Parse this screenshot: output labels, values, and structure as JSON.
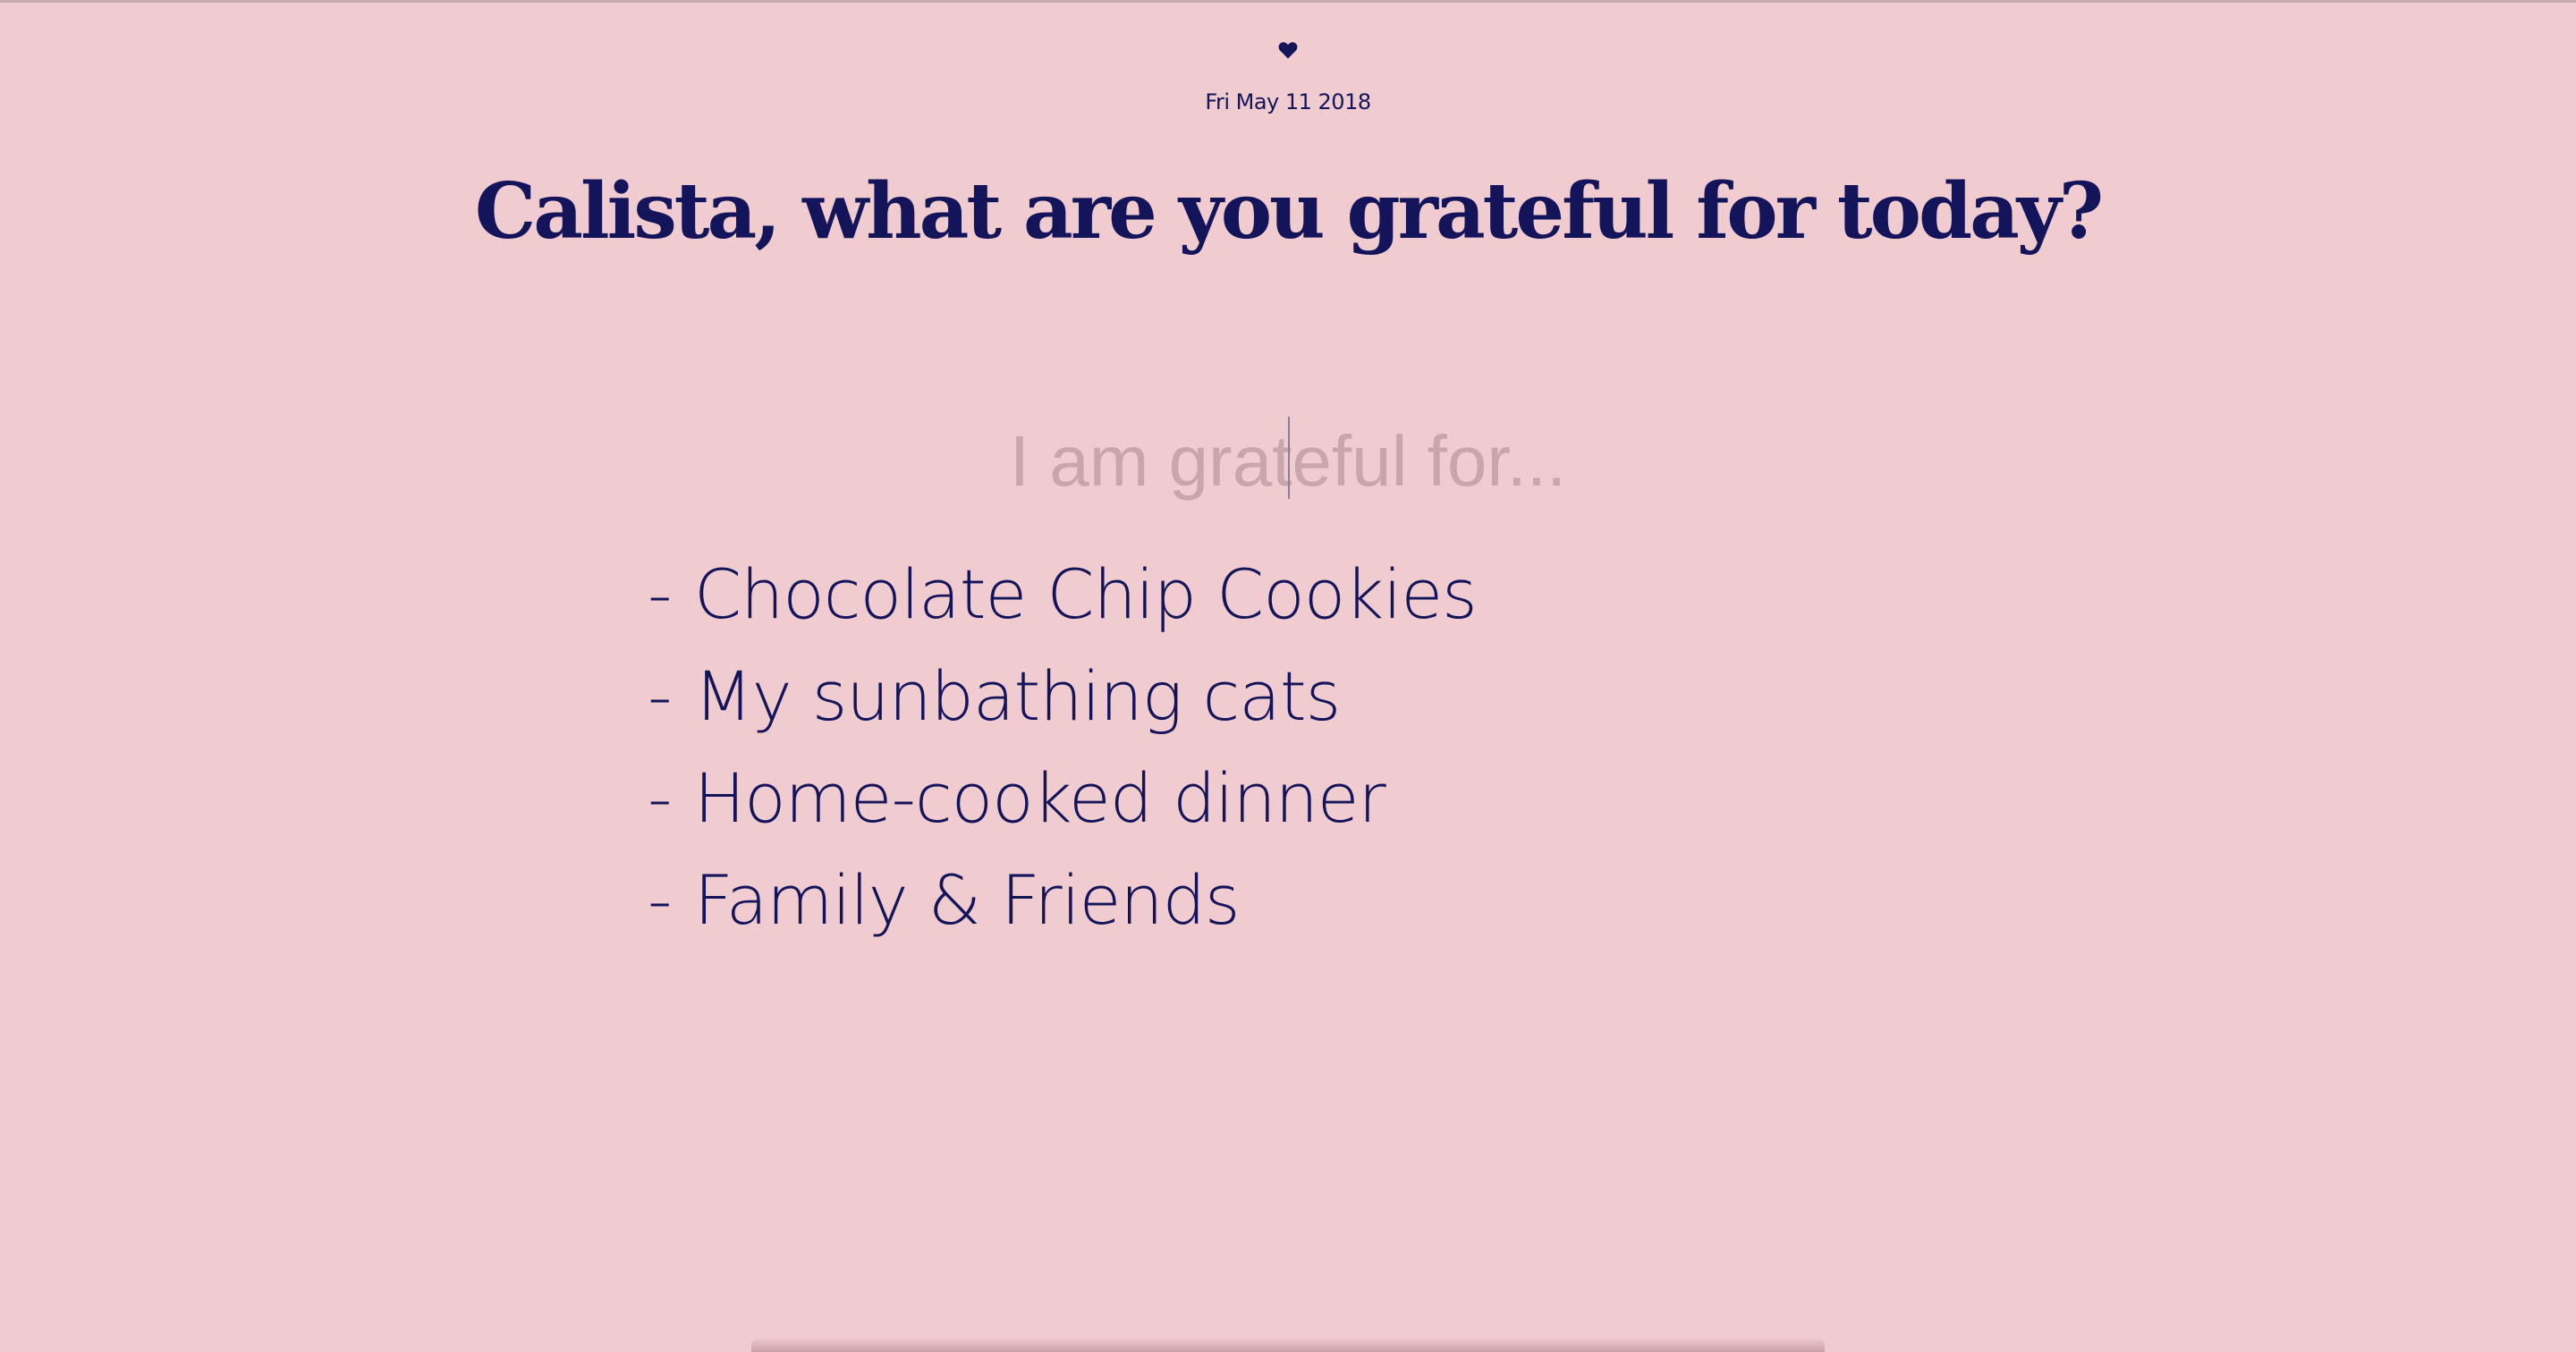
{
  "header": {
    "icon": "heart-icon",
    "date": "Fri May 11 2018"
  },
  "main": {
    "title": "Calista, what are you grateful for today?",
    "entry": {
      "placeholder": "I am grateful for...",
      "value": ""
    },
    "list": {
      "bullet": "-",
      "items": [
        "Chocolate Chip Cookies",
        "My sunbathing cats",
        "Home-cooked dinner",
        "Family & Friends"
      ]
    }
  },
  "colors": {
    "background": "#f0cbcf",
    "text": "#14145a",
    "placeholder": "#c8a6ab"
  }
}
